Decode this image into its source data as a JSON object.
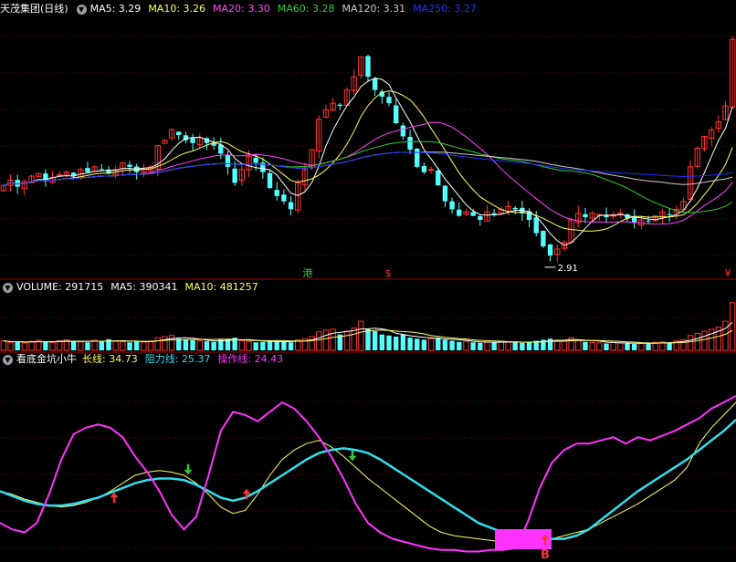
{
  "colors": {
    "background": "#000000",
    "grid": "#7a0000",
    "panel_border": "#a00000",
    "up": "#ff3232",
    "down": "#54ffff",
    "ma5": "#ffffff",
    "ma10": "#ffff66",
    "ma20": "#ff44ff",
    "ma60": "#33cc33",
    "ma120": "#cccccc",
    "ma250": "#2233ff",
    "long_line": "#ffff66",
    "resistance_line": "#33ddee",
    "operation_line": "#ff33ff"
  },
  "price_panel": {
    "title": "天茂集团(日线)",
    "indicators": [
      {
        "name": "MA5",
        "value": "3.29",
        "color": "#ffffff"
      },
      {
        "name": "MA10",
        "value": "3.26",
        "color": "#ffff66"
      },
      {
        "name": "MA20",
        "value": "3.30",
        "color": "#ff44ff"
      },
      {
        "name": "MA60",
        "value": "3.28",
        "color": "#33cc33"
      },
      {
        "name": "MA120",
        "value": "3.31",
        "color": "#cccccc"
      },
      {
        "name": "MA250",
        "value": "3.27",
        "color": "#2233ff"
      }
    ],
    "low_annotation": "2.91",
    "markers": [
      {
        "text": "港",
        "color": "#33cc33"
      },
      {
        "text": "$",
        "color": "#ff3232"
      },
      {
        "text": "¥",
        "color": "#ff3232"
      }
    ]
  },
  "volume_panel": {
    "indicators": [
      {
        "name": "VOLUME",
        "value": "291715",
        "color": "#ffffff"
      },
      {
        "name": "MA5",
        "value": "390341",
        "color": "#ffffff"
      },
      {
        "name": "MA10",
        "value": "481257",
        "color": "#ffff66"
      }
    ]
  },
  "indicator_panel": {
    "title": "看底金坑小牛",
    "indicators": [
      {
        "name": "长线",
        "value": "34.73",
        "color": "#ffff66"
      },
      {
        "name": "阻力线",
        "value": "25.37",
        "color": "#33ddee"
      },
      {
        "name": "操作线",
        "value": "24.43",
        "color": "#ff33ff"
      }
    ],
    "signal_label": "B"
  },
  "chart_data": [
    {
      "type": "candlestick",
      "title": "天茂集团(日线)",
      "ylim": [
        2.8,
        4.7
      ],
      "series_names": [
        "MA5",
        "MA10",
        "MA20",
        "MA60",
        "MA120",
        "MA250"
      ],
      "close": [
        3.48,
        3.52,
        3.47,
        3.51,
        3.55,
        3.57,
        3.52,
        3.54,
        3.56,
        3.58,
        3.55,
        3.6,
        3.58,
        3.62,
        3.6,
        3.57,
        3.6,
        3.65,
        3.62,
        3.58,
        3.6,
        3.62,
        3.78,
        3.82,
        3.9,
        3.86,
        3.82,
        3.8,
        3.84,
        3.8,
        3.78,
        3.72,
        3.62,
        3.5,
        3.6,
        3.7,
        3.65,
        3.58,
        3.46,
        3.4,
        3.36,
        3.3,
        3.5,
        3.6,
        3.75,
        3.98,
        4.05,
        4.1,
        4.08,
        4.2,
        4.3,
        4.45,
        4.3,
        4.2,
        4.15,
        4.1,
        3.95,
        3.85,
        3.75,
        3.62,
        3.58,
        3.6,
        3.48,
        3.36,
        3.3,
        3.25,
        3.28,
        3.25,
        3.22,
        3.28,
        3.26,
        3.3,
        3.32,
        3.3,
        3.27,
        3.22,
        3.12,
        3.02,
        2.95,
        3.0,
        3.05,
        3.22,
        3.27,
        3.24,
        3.27,
        3.26,
        3.24,
        3.26,
        3.27,
        3.23,
        3.2,
        3.22,
        3.21,
        3.25,
        3.28,
        3.26,
        3.3,
        3.36,
        3.62,
        3.76,
        3.85,
        3.9,
        3.96,
        4.08,
        4.58
      ],
      "annotations": [
        "2.91",
        "港",
        "$",
        "¥"
      ]
    },
    {
      "type": "bar",
      "series_names": [
        "VOLUME",
        "MA5",
        "MA10"
      ],
      "values": [
        18,
        15,
        16,
        14,
        17,
        19,
        16,
        15,
        18,
        20,
        17,
        16,
        15,
        19,
        18,
        21,
        17,
        16,
        15,
        18,
        16,
        17,
        24,
        26,
        28,
        22,
        20,
        19,
        18,
        17,
        16,
        20,
        22,
        24,
        18,
        17,
        15,
        16,
        18,
        17,
        16,
        15,
        20,
        22,
        26,
        35,
        38,
        40,
        30,
        36,
        42,
        55,
        40,
        36,
        30,
        28,
        26,
        30,
        24,
        22,
        20,
        22,
        24,
        20,
        18,
        16,
        17,
        15,
        14,
        16,
        15,
        17,
        16,
        15,
        14,
        16,
        18,
        20,
        22,
        19,
        17,
        24,
        20,
        16,
        15,
        14,
        13,
        15,
        14,
        13,
        12,
        13,
        14,
        15,
        16,
        14,
        18,
        20,
        28,
        32,
        36,
        40,
        44,
        55,
        90
      ]
    },
    {
      "type": "line",
      "title": "看底金坑小牛",
      "ylim": [
        0,
        100
      ],
      "series": [
        {
          "name": "长线",
          "values": [
            40,
            38,
            35,
            33,
            31,
            30,
            31,
            33,
            36,
            40,
            45,
            50,
            52,
            53,
            52,
            50,
            45,
            38,
            30,
            26,
            28,
            38,
            50,
            60,
            66,
            70,
            72,
            68,
            62,
            55,
            48,
            42,
            36,
            30,
            24,
            18,
            14,
            12,
            11,
            10,
            9,
            8,
            8,
            8,
            9,
            10,
            12,
            14,
            16,
            20,
            24,
            28,
            32,
            37,
            42,
            47,
            55,
            70,
            80,
            88,
            96
          ]
        },
        {
          "name": "阻力线",
          "values": [
            40,
            37,
            34,
            32,
            31,
            31,
            32,
            34,
            36,
            39,
            42,
            45,
            47,
            48,
            48,
            47,
            44,
            40,
            36,
            34,
            36,
            40,
            45,
            50,
            55,
            60,
            64,
            66,
            67,
            66,
            64,
            60,
            55,
            50,
            45,
            40,
            35,
            30,
            25,
            20,
            17,
            14,
            12,
            11,
            10,
            10,
            10,
            12,
            16,
            22,
            28,
            34,
            40,
            45,
            50,
            55,
            60,
            66,
            72,
            78,
            85
          ]
        },
        {
          "name": "操作线",
          "values": [
            20,
            16,
            14,
            20,
            38,
            60,
            76,
            80,
            82,
            80,
            74,
            62,
            52,
            40,
            25,
            16,
            24,
            50,
            78,
            90,
            88,
            84,
            90,
            96,
            92,
            84,
            74,
            62,
            48,
            32,
            20,
            14,
            10,
            8,
            6,
            4,
            3,
            3,
            2,
            2,
            3,
            3,
            4,
            20,
            42,
            58,
            66,
            70,
            70,
            72,
            74,
            70,
            74,
            72,
            75,
            78,
            82,
            86,
            92,
            96,
            100
          ]
        }
      ],
      "signal_label": "B"
    }
  ]
}
